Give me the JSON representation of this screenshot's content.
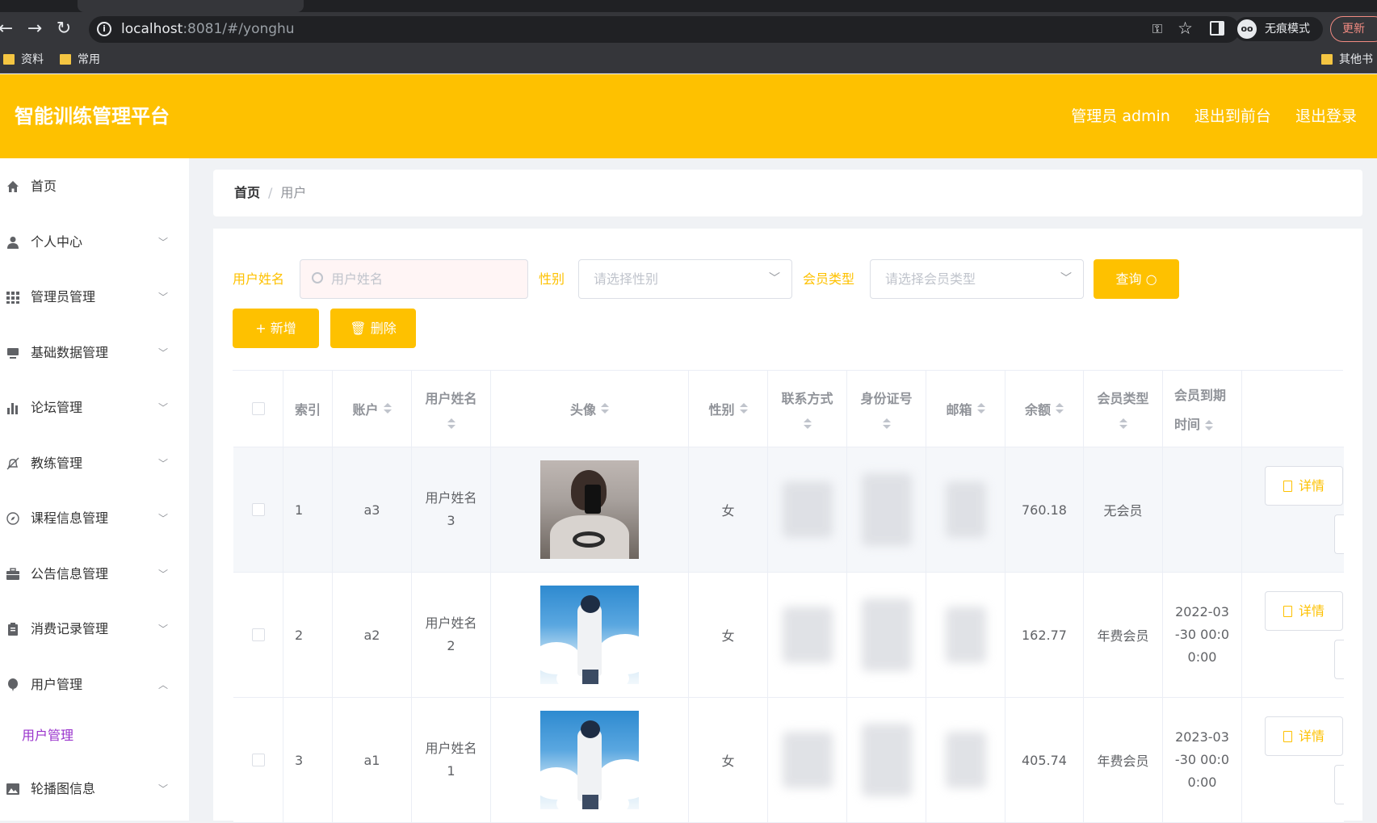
{
  "browser": {
    "url_host": "localhost",
    "url_rest": ":8081/#/yonghu",
    "incognito_label": "无痕模式",
    "update_label": "更新",
    "bookmarks": [
      "资料",
      "常用",
      "其他书"
    ]
  },
  "header": {
    "title": "智能训练管理平台",
    "admin": "管理员 admin",
    "exit_front": "退出到前台",
    "logout": "退出登录"
  },
  "sidebar": {
    "items": [
      {
        "label": "首页",
        "icon": "home-icon"
      },
      {
        "label": "个人中心",
        "icon": "user-icon"
      },
      {
        "label": "管理员管理",
        "icon": "grid-icon"
      },
      {
        "label": "基础数据管理",
        "icon": "monitor-icon"
      },
      {
        "label": "论坛管理",
        "icon": "bar-chart-icon"
      },
      {
        "label": "教练管理",
        "icon": "bell-off-icon"
      },
      {
        "label": "课程信息管理",
        "icon": "compass-icon"
      },
      {
        "label": "公告信息管理",
        "icon": "briefcase-icon"
      },
      {
        "label": "消费记录管理",
        "icon": "clipboard-icon"
      },
      {
        "label": "用户管理",
        "icon": "balloon-icon"
      },
      {
        "label": "轮播图信息",
        "icon": "image-icon"
      }
    ],
    "sub_active": "用户管理"
  },
  "breadcrumb": {
    "home": "首页",
    "separator": "/",
    "current": "用户"
  },
  "search": {
    "name_label": "用户姓名",
    "name_placeholder": "用户姓名",
    "gender_label": "性别",
    "gender_placeholder": "请选择性别",
    "member_label": "会员类型",
    "member_placeholder": "请选择会员类型",
    "query_label": "查询"
  },
  "actions": {
    "add_label": "+ 新增",
    "delete_label": "删除"
  },
  "table": {
    "headers": {
      "index": "索引",
      "account": "账户",
      "name_1": "用户姓名",
      "avatar": "头像",
      "gender": "性别",
      "contact": "联系方式",
      "id_card": "身份证号",
      "email": "邮箱",
      "balance": "余额",
      "member_type": "会员类型",
      "expire_1": "会员到期",
      "expire_2": "时间"
    },
    "rows": [
      {
        "index": "1",
        "account": "a3",
        "name_1": "用户姓名",
        "name_2": "3",
        "gender": "女",
        "balance": "760.18",
        "member_type": "无会员",
        "expire_1": "",
        "expire_2": "",
        "expire_3": "",
        "detail": "详情"
      },
      {
        "index": "2",
        "account": "a2",
        "name_1": "用户姓名",
        "name_2": "2",
        "gender": "女",
        "balance": "162.77",
        "member_type": "年费会员",
        "expire_1": "2022-03",
        "expire_2": "-30 00:0",
        "expire_3": "0:00",
        "detail": "详情"
      },
      {
        "index": "3",
        "account": "a1",
        "name_1": "用户姓名",
        "name_2": "1",
        "gender": "女",
        "balance": "405.74",
        "member_type": "年费会员",
        "expire_1": "2023-03",
        "expire_2": "-30 00:0",
        "expire_3": "0:00",
        "detail": "详情"
      }
    ]
  },
  "colors": {
    "accent": "#fec100",
    "submenu_active": "#9932cc"
  }
}
